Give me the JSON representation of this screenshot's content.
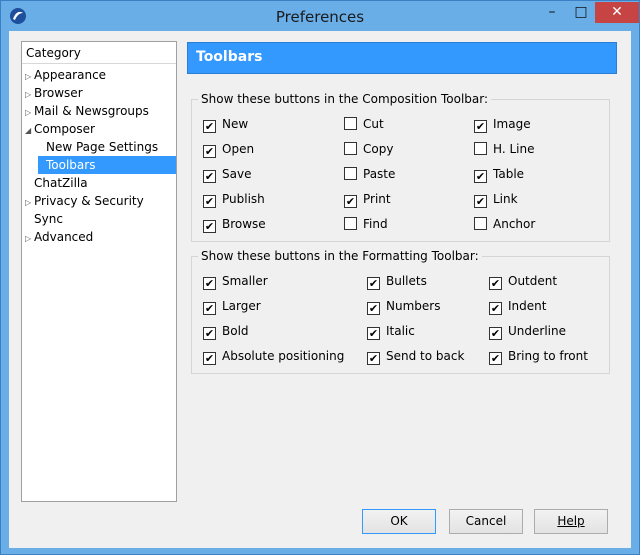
{
  "window": {
    "title": "Preferences"
  },
  "window_controls": {
    "minimize": "–",
    "maximize": "□",
    "close": "✕"
  },
  "category": {
    "header": "Category",
    "items": [
      {
        "label": "Appearance",
        "expanded": false,
        "level": 0
      },
      {
        "label": "Browser",
        "expanded": false,
        "level": 0
      },
      {
        "label": "Mail & Newsgroups",
        "expanded": false,
        "level": 0
      },
      {
        "label": "Composer",
        "expanded": true,
        "level": 0
      },
      {
        "label": "New Page Settings",
        "level": 1
      },
      {
        "label": "Toolbars",
        "level": 1,
        "selected": true
      },
      {
        "label": "ChatZilla",
        "level": 0
      },
      {
        "label": "Privacy & Security",
        "expanded": false,
        "level": 0
      },
      {
        "label": "Sync",
        "level": 0
      },
      {
        "label": "Advanced",
        "expanded": false,
        "level": 0
      }
    ]
  },
  "panel": {
    "title": "Toolbars"
  },
  "composition": {
    "title": "Show these buttons in the Composition Toolbar:",
    "col1": [
      {
        "label": "New",
        "checked": true
      },
      {
        "label": "Open",
        "checked": true
      },
      {
        "label": "Save",
        "checked": true
      },
      {
        "label": "Publish",
        "checked": true
      },
      {
        "label": "Browse",
        "checked": true
      }
    ],
    "col2": [
      {
        "label": "Cut",
        "checked": false
      },
      {
        "label": "Copy",
        "checked": false
      },
      {
        "label": "Paste",
        "checked": false
      },
      {
        "label": "Print",
        "checked": true
      },
      {
        "label": "Find",
        "checked": false
      }
    ],
    "col3": [
      {
        "label": "Image",
        "checked": true
      },
      {
        "label": "H. Line",
        "checked": false
      },
      {
        "label": "Table",
        "checked": true
      },
      {
        "label": "Link",
        "checked": true
      },
      {
        "label": "Anchor",
        "checked": false
      }
    ]
  },
  "formatting": {
    "title": "Show these buttons in the Formatting Toolbar:",
    "col1": [
      {
        "label": "Smaller",
        "checked": true
      },
      {
        "label": "Larger",
        "checked": true
      },
      {
        "label": "Bold",
        "checked": true
      },
      {
        "label": "Absolute positioning",
        "checked": true
      }
    ],
    "col2": [
      {
        "label": "Bullets",
        "checked": true
      },
      {
        "label": "Numbers",
        "checked": true
      },
      {
        "label": "Italic",
        "checked": true
      },
      {
        "label": "Send to back",
        "checked": true
      }
    ],
    "col3": [
      {
        "label": "Outdent",
        "checked": true
      },
      {
        "label": "Indent",
        "checked": true
      },
      {
        "label": "Underline",
        "checked": true
      },
      {
        "label": "Bring to front",
        "checked": true
      }
    ]
  },
  "buttons": {
    "ok": "OK",
    "cancel": "Cancel",
    "help": "Help"
  },
  "colors": {
    "accent": "#3399ff",
    "titlebar": "#6aaee8",
    "close": "#c74444"
  }
}
